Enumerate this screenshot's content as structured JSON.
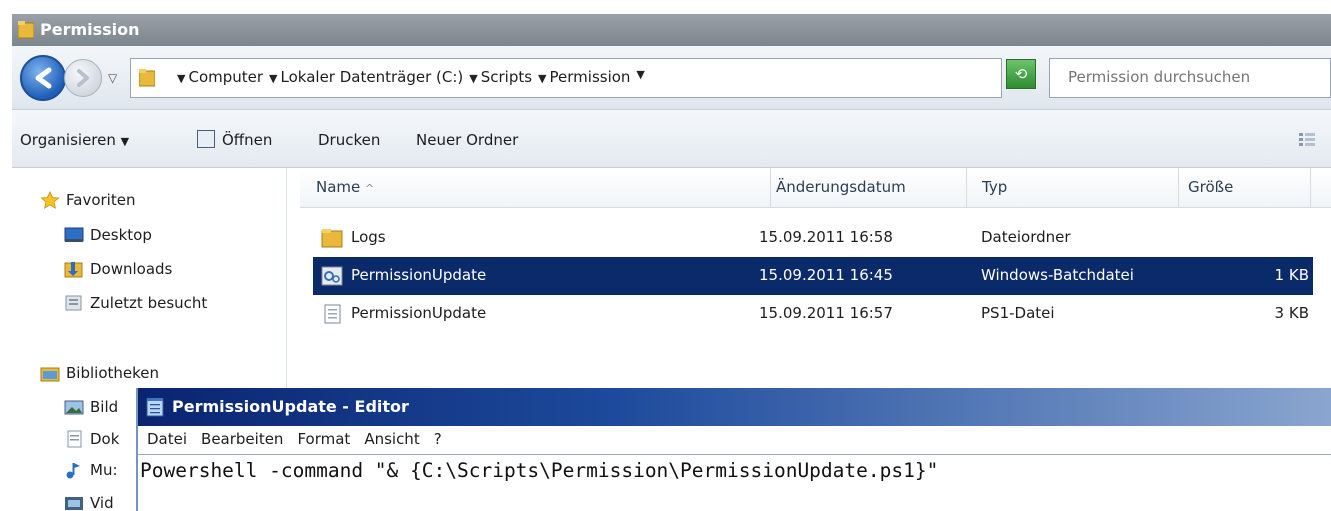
{
  "explorer": {
    "title": "Permission",
    "address": {
      "crumbs": [
        "Computer",
        "Lokaler Datenträger (C:)",
        "Scripts",
        "Permission"
      ]
    },
    "search": {
      "placeholder": "Permission durchsuchen"
    },
    "toolbar": {
      "organize_label": "Organisieren",
      "organize_arrow": "▼",
      "open_label": "Öffnen",
      "print_label": "Drucken",
      "new_folder_label": "Neuer Ordner"
    },
    "sidebar": {
      "favorites_label": "Favoriten",
      "favorites": [
        "Desktop",
        "Downloads",
        "Zuletzt besucht"
      ],
      "libraries_label": "Bibliotheken",
      "libraries_partial": [
        "Bild",
        "Dok",
        "Mu:",
        "Vid"
      ]
    },
    "columns": {
      "name": "Name",
      "name_sort_indicator": "^",
      "modified": "Änderungsdatum",
      "type": "Typ",
      "size": "Größe"
    },
    "files": [
      {
        "name": "Logs",
        "modified": "15.09.2011 16:58",
        "type": "Dateiordner",
        "size": "",
        "icon": "folder-icon",
        "selected": false
      },
      {
        "name": "PermissionUpdate",
        "modified": "15.09.2011 16:45",
        "type": "Windows-Batchdatei",
        "size": "1 KB",
        "icon": "batch-file-icon",
        "selected": true
      },
      {
        "name": "PermissionUpdate",
        "modified": "15.09.2011 16:57",
        "type": "PS1-Datei",
        "size": "3 KB",
        "icon": "text-file-icon",
        "selected": false
      }
    ]
  },
  "editor": {
    "title": "PermissionUpdate - Editor",
    "menu": [
      "Datei",
      "Bearbeiten",
      "Format",
      "Ansicht",
      "?"
    ],
    "content": "Powershell -command \"& {C:\\Scripts\\Permission\\PermissionUpdate.ps1}\""
  },
  "colors": {
    "selection": "#0a2a6a",
    "editor_title_start": "#0a2470",
    "folder_yellow": "#e8b93a"
  }
}
